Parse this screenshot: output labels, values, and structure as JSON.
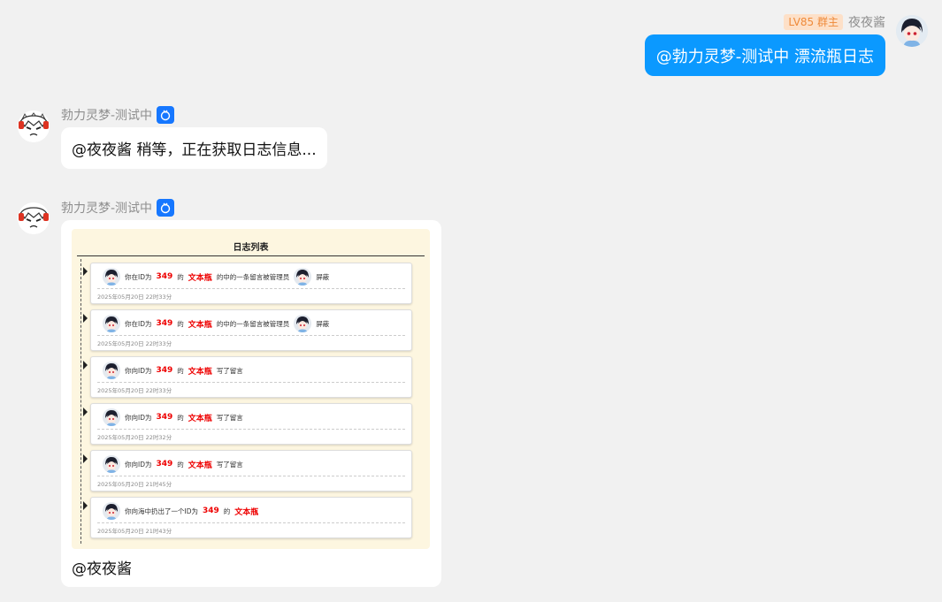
{
  "chat": {
    "user": {
      "level_badge": "LV85 群主",
      "name": "夜夜酱",
      "message": "@勃力灵梦-测试中 漂流瓶日志"
    },
    "bot": {
      "name": "勃力灵梦-测试中",
      "reply_1": "@夜夜酱 稍等，正在获取日志信息...",
      "reply_2_mention": "@夜夜酱"
    }
  },
  "log": {
    "title": "日志列表",
    "entries": [
      {
        "prefix": "你在ID为",
        "id": "349",
        "mid": "的",
        "type": "文本瓶",
        "suffix": "的中的一条留言被管理员",
        "action": "屏蔽",
        "has_admin": true,
        "time": "2025年05月20日 22时33分"
      },
      {
        "prefix": "你在ID为",
        "id": "349",
        "mid": "的",
        "type": "文本瓶",
        "suffix": "的中的一条留言被管理员",
        "action": "屏蔽",
        "has_admin": true,
        "time": "2025年05月20日 22时33分"
      },
      {
        "prefix": "你向ID为",
        "id": "349",
        "mid": "的",
        "type": "文本瓶",
        "suffix": "写了留言",
        "action": "",
        "has_admin": false,
        "time": "2025年05月20日 22时33分"
      },
      {
        "prefix": "你向ID为",
        "id": "349",
        "mid": "的",
        "type": "文本瓶",
        "suffix": "写了留言",
        "action": "",
        "has_admin": false,
        "time": "2025年05月20日 22时32分"
      },
      {
        "prefix": "你向ID为",
        "id": "349",
        "mid": "的",
        "type": "文本瓶",
        "suffix": "写了留言",
        "action": "",
        "has_admin": false,
        "time": "2025年05月20日 21时45分"
      },
      {
        "prefix": "你向海中扔出了一个ID为",
        "id": "349",
        "mid": "的",
        "type": "文本瓶",
        "suffix": "",
        "action": "",
        "has_admin": false,
        "time": "2025年05月20日 21时43分"
      }
    ]
  },
  "colors": {
    "user_bubble": "#0b99ff",
    "bot_badge": "#1677ff",
    "log_bg": "#fdf6e0",
    "highlight": "#ee0000"
  }
}
